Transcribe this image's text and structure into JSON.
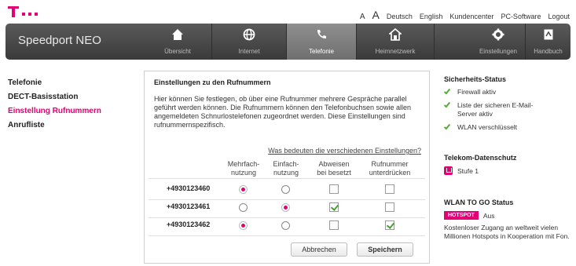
{
  "colors": {
    "brand": "#e20074",
    "check": "#4a9e3a",
    "nav_bg": "#4a4a4a"
  },
  "top_links": [
    "A",
    "A",
    "Deutsch",
    "English",
    "Kundencenter",
    "PC-Software",
    "Logout"
  ],
  "brand_name": "Speedport NEO",
  "nav": [
    {
      "label": "Übersicht",
      "icon": "home-icon"
    },
    {
      "label": "Internet",
      "icon": "globe-icon"
    },
    {
      "label": "Telefonie",
      "icon": "phone-icon",
      "active": true
    },
    {
      "label": "Heimnetzwerk",
      "icon": "house-network-icon"
    },
    {
      "label": "Einstellungen",
      "icon": "gear-icon"
    },
    {
      "label": "Handbuch",
      "icon": "manual-icon"
    }
  ],
  "sidebar": [
    {
      "label": "Telefonie"
    },
    {
      "label": "DECT-Basisstation"
    },
    {
      "label": "Einstellung Rufnummern",
      "active": true
    },
    {
      "label": "Anrufliste"
    }
  ],
  "panel": {
    "title": "Einstellungen zu den Rufnummern",
    "description": "Hier können Sie festlegen, ob über eine Rufnummer mehrere Gespräche parallel geführt werden können. Die Rufnummern können den Telefonbuchsen sowie allen angemeldeten Schnurlostelefonen zugeordnet werden. Diese Einstellungen sind rufnummernspezifisch.",
    "help_link": "Was bedeuten die verschiedenen Einstellungen?",
    "columns": {
      "mehrfach_1": "Mehrfach-",
      "mehrfach_2": "nutzung",
      "einfach_1": "Einfach-",
      "einfach_2": "nutzung",
      "abweisen_1": "Abweisen",
      "abweisen_2": "bei besetzt",
      "unterdr_1": "Rufnummer",
      "unterdr_2": "unterdrücken"
    },
    "rows": [
      {
        "number": "+4930123460",
        "mehrfach": true,
        "einfach": false,
        "abweisen": false,
        "unterdruecken": false
      },
      {
        "number": "+4930123461",
        "mehrfach": false,
        "einfach": true,
        "abweisen": true,
        "unterdruecken": false
      },
      {
        "number": "+4930123462",
        "mehrfach": true,
        "einfach": false,
        "abweisen": false,
        "unterdruecken": true
      }
    ],
    "cancel_label": "Abbrechen",
    "save_label": "Speichern"
  },
  "right": {
    "security_title": "Sicherheits-Status",
    "security_items": [
      "Firewall aktiv",
      "Liste der sicheren E-Mail-Server aktiv",
      "WLAN verschlüsselt"
    ],
    "privacy_title": "Telekom-Datenschutz",
    "privacy_level": "Stufe 1",
    "wlan_title": "WLAN TO GO Status",
    "hotspot_badge": "HOTSPOT",
    "hotspot_state": "Aus",
    "wlan_text": "Kostenloser Zugang an weltweit vielen Millionen Hotspots in Kooperation mit Fon."
  }
}
